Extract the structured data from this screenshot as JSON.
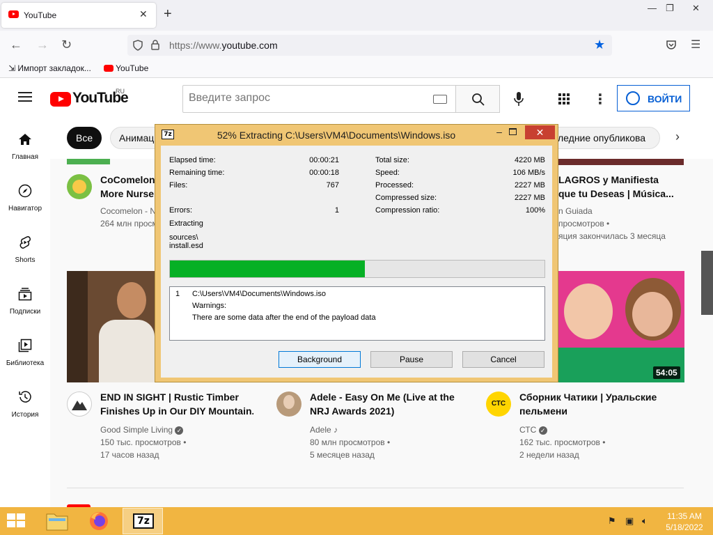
{
  "browser": {
    "tab_title": "YouTube",
    "url_prefix": "https://www.",
    "url_domain": "youtube.com",
    "bookmarks": [
      {
        "label": "Импорт закладок..."
      },
      {
        "label": "YouTube"
      }
    ]
  },
  "youtube": {
    "logo_text": "YouTube",
    "logo_region": "RU",
    "search_placeholder": "Введите запрос",
    "login_label": "ВОЙТИ",
    "sidebar": [
      {
        "label": "Главная",
        "icon": "home-icon"
      },
      {
        "label": "Навигатор",
        "icon": "compass-icon"
      },
      {
        "label": "Shorts",
        "icon": "shorts-icon"
      },
      {
        "label": "Подписки",
        "icon": "subscriptions-icon"
      },
      {
        "label": "Библиотека",
        "icon": "library-icon"
      },
      {
        "label": "История",
        "icon": "history-icon"
      }
    ],
    "chips": [
      {
        "label": "Все"
      },
      {
        "label": "Анимац"
      },
      {
        "label": "ледние опубликова"
      }
    ],
    "videos_row1": [
      {
        "title_line1": "CoComelon -",
        "title_line2": "More Nurser",
        "channel": "Cocomelon - N",
        "views": "264 млн просм"
      },
      {
        "title_line1": "LAGROS y Manifiesta",
        "title_line2": "que tu Deseas | Música...",
        "channel": "n Guiada",
        "views": "просмотров •",
        "age": "яция закончилась 3 месяца"
      }
    ],
    "videos_row2": [
      {
        "title_line1": "END IN SIGHT | Rustic Timber",
        "title_line2": "Finishes Up in Our DIY Mountain...",
        "channel": "Good Simple Living",
        "views": "150 тыс. просмотров •",
        "age": "17 часов назад"
      },
      {
        "title_line1": "Adele - Easy On Me (Live at the",
        "title_line2": "NRJ Awards 2021)",
        "channel": "Adele",
        "views": "80 млн просмотров •",
        "age": "5 месяцев назад"
      },
      {
        "title_line1": "Сборник Чатики | Уральские",
        "title_line2": "пельмени",
        "channel": "СТС",
        "avatar_text": "СТС",
        "views": "162 тыс. просмотров •",
        "age": "2 недели назад",
        "duration": "54:05"
      }
    ]
  },
  "dialog": {
    "app_icon": "7z",
    "title": "52% Extracting C:\\Users\\VM4\\Documents\\Windows.iso",
    "progress": 0.52,
    "left": [
      {
        "label": "Elapsed time:",
        "value": "00:00:21"
      },
      {
        "label": "Remaining time:",
        "value": "00:00:18"
      },
      {
        "label": "Files:",
        "value": "767"
      },
      {
        "label": "Errors:",
        "value": "1"
      }
    ],
    "right": [
      {
        "label": "Total size:",
        "value": "4220 MB"
      },
      {
        "label": "Speed:",
        "value": "106 MB/s"
      },
      {
        "label": "Processed:",
        "value": "2227 MB"
      },
      {
        "label": "Compressed size:",
        "value": "2227 MB"
      },
      {
        "label": "Compression ratio:",
        "value": "100%"
      }
    ],
    "extracting_label": "Extracting",
    "current_file_line1": "sources\\",
    "current_file_line2": "install.esd",
    "log": {
      "index": "1",
      "path": "C:\\Users\\VM4\\Documents\\Windows.iso",
      "warnings_label": "Warnings:",
      "message": "There are some data after the end of the payload data"
    },
    "buttons": {
      "background": "Background",
      "pause": "Pause",
      "cancel": "Cancel"
    }
  },
  "taskbar": {
    "time": "11:35 AM",
    "date": "5/18/2022",
    "active_app": "7z"
  },
  "colors": {
    "taskbar": "#f1b541",
    "dialog_frame": "#f0c674",
    "progress_fill": "#06b025",
    "youtube_red": "#ff0000",
    "login_blue": "#065fd4"
  }
}
